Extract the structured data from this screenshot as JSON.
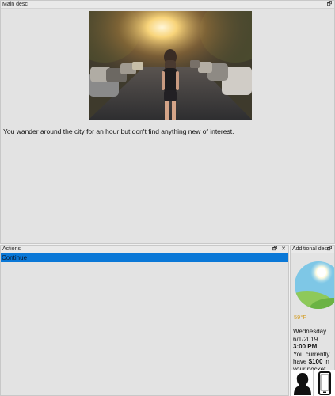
{
  "main_panel": {
    "title": "Main desc",
    "description": "You wander around the city for an hour but don't find anything new of interest."
  },
  "actions_panel": {
    "title": "Actions",
    "items": [
      {
        "label": "Continue"
      }
    ]
  },
  "additional_panel": {
    "title": "Additional desc",
    "temperature": "59°F",
    "day": "Wednesday",
    "date": "6/1/2019",
    "time": "3:00 PM",
    "money_prefix": "You currently have",
    "money": "$100",
    "money_suffix": "in your pocket"
  },
  "window_controls": {
    "float": "🗗",
    "close": "✕"
  },
  "colors": {
    "selection": "#0a78d7",
    "temperature": "#d4a02c"
  }
}
